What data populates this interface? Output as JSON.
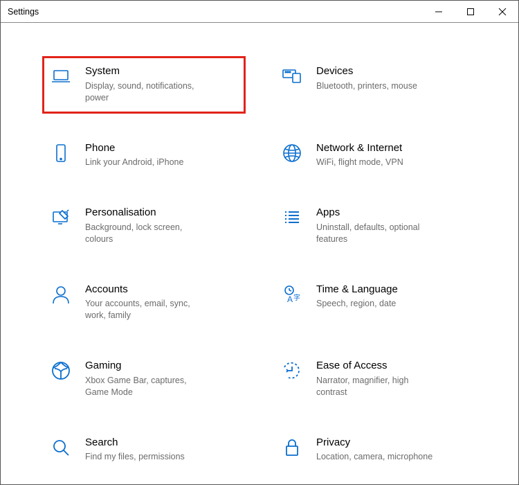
{
  "window": {
    "title": "Settings"
  },
  "tiles": [
    {
      "title": "System",
      "desc": "Display, sound, notifications, power"
    },
    {
      "title": "Devices",
      "desc": "Bluetooth, printers, mouse"
    },
    {
      "title": "Phone",
      "desc": "Link your Android, iPhone"
    },
    {
      "title": "Network & Internet",
      "desc": "WiFi, flight mode, VPN"
    },
    {
      "title": "Personalisation",
      "desc": "Background, lock screen, colours"
    },
    {
      "title": "Apps",
      "desc": "Uninstall, defaults, optional features"
    },
    {
      "title": "Accounts",
      "desc": "Your accounts, email, sync, work, family"
    },
    {
      "title": "Time & Language",
      "desc": "Speech, region, date"
    },
    {
      "title": "Gaming",
      "desc": "Xbox Game Bar, captures, Game Mode"
    },
    {
      "title": "Ease of Access",
      "desc": "Narrator, magnifier, high contrast"
    },
    {
      "title": "Search",
      "desc": "Find my files, permissions"
    },
    {
      "title": "Privacy",
      "desc": "Location, camera, microphone"
    }
  ],
  "highlighted_tile_index": 0
}
